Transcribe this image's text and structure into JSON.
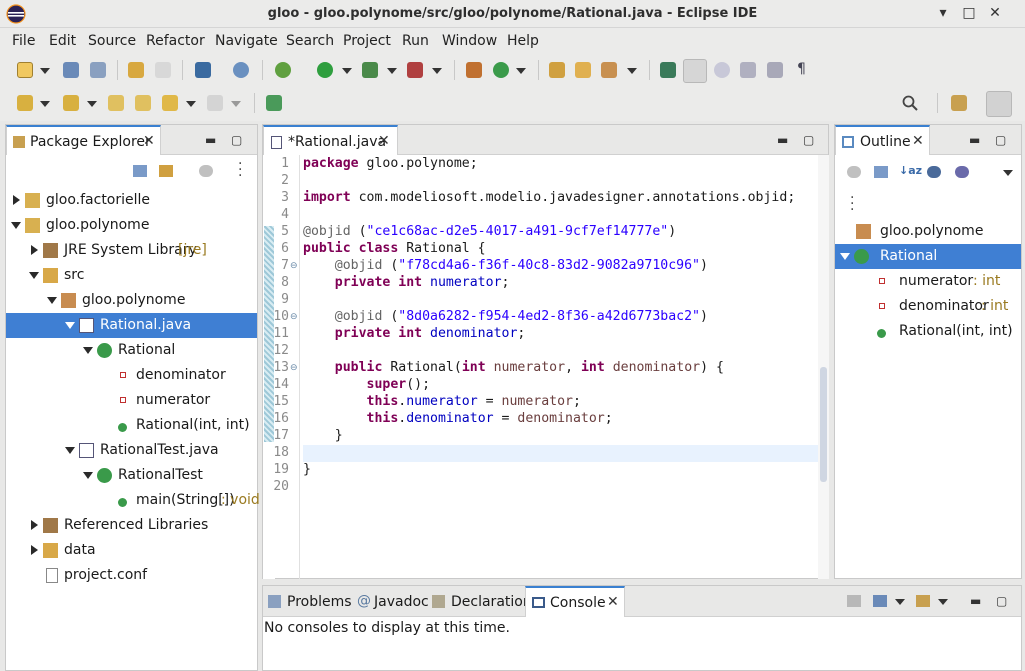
{
  "window": {
    "title": "gloo - gloo.polynome/src/gloo/polynome/Rational.java - Eclipse IDE",
    "min": "▾",
    "max": "□",
    "close": "✕"
  },
  "menu": [
    "File",
    "Edit",
    "Source",
    "Refactor",
    "Navigate",
    "Search",
    "Project",
    "Run",
    "Window",
    "Help"
  ],
  "package_explorer": {
    "title": "Package Explorer",
    "items": [
      {
        "label": "gloo.factorielle",
        "icon": "project-icon"
      },
      {
        "label": "gloo.polynome",
        "icon": "project-icon"
      },
      {
        "label": "JRE System Library",
        "suffix": "[jre]",
        "icon": "library-icon"
      },
      {
        "label": "src",
        "icon": "folder-icon"
      },
      {
        "label": "gloo.polynome",
        "icon": "package-icon"
      },
      {
        "label": "Rational.java",
        "icon": "java-file-icon"
      },
      {
        "label": "Rational",
        "icon": "class-icon"
      },
      {
        "label": "denominator",
        "icon": "field-icon"
      },
      {
        "label": "numerator",
        "icon": "field-icon"
      },
      {
        "label": "Rational(int, int)",
        "icon": "constructor-icon"
      },
      {
        "label": "RationalTest.java",
        "icon": "java-file-icon"
      },
      {
        "label": "RationalTest",
        "icon": "class-icon"
      },
      {
        "label": "main(String[])",
        "suffix": " : void",
        "icon": "method-icon"
      },
      {
        "label": "Referenced Libraries",
        "icon": "library-icon"
      },
      {
        "label": "data",
        "icon": "folder-icon"
      },
      {
        "label": "project.conf",
        "icon": "file-icon"
      }
    ]
  },
  "editor": {
    "tab": "*Rational.java",
    "lines": [
      "1",
      "2",
      "3",
      "4",
      "5",
      "6",
      "7",
      "8",
      "9",
      "10",
      "11",
      "12",
      "13",
      "14",
      "15",
      "16",
      "17",
      "18",
      "19",
      "20"
    ],
    "code": {
      "l1a": "package",
      "l1b": " gloo.polynome;",
      "l3a": "import",
      "l3b": " com.modeliosoft.modelio.javadesigner.annotations.objid;",
      "l5a": "@objid",
      "l5b": " (",
      "l5c": "\"ce1c68ac-d2e5-4017-a491-9cf7ef14777e\"",
      "l5d": ")",
      "l6a": "public class",
      "l6b": " Rational {",
      "l7a": "    @objid",
      "l7b": " (",
      "l7c": "\"f78cd4a6-f36f-40c8-83d2-9082a9710c96\"",
      "l7d": ")",
      "l8a": "    private int",
      "l8b": " ",
      "l8c": "numerator",
      "l8d": ";",
      "l10a": "    @objid",
      "l10b": " (",
      "l10c": "\"8d0a6282-f954-4ed2-8f36-a42d6773bac2\"",
      "l10d": ")",
      "l11a": "    private int",
      "l11b": " ",
      "l11c": "denominator",
      "l11d": ";",
      "l13a": "    public",
      "l13b": " Rational(",
      "l13c": "int",
      "l13d": " ",
      "l13e": "numerator",
      "l13f": ", ",
      "l13g": "int",
      "l13h": " ",
      "l13i": "denominator",
      "l13j": ") {",
      "l14a": "        super",
      "l14b": "();",
      "l15a": "        this",
      "l15b": ".",
      "l15c": "numerator",
      "l15d": " = ",
      "l15e": "numerator",
      "l15f": ";",
      "l16a": "        this",
      "l16b": ".",
      "l16c": "denominator",
      "l16d": " = ",
      "l16e": "denominator",
      "l16f": ";",
      "l17": "    }",
      "l19": "}"
    }
  },
  "outline": {
    "title": "Outline",
    "items": [
      {
        "label": "gloo.polynome",
        "icon": "package-icon"
      },
      {
        "label": "Rational",
        "icon": "class-icon"
      },
      {
        "label": "numerator",
        "suffix": " : int",
        "icon": "field-icon"
      },
      {
        "label": "denominator",
        "suffix": " : int",
        "icon": "field-icon"
      },
      {
        "label": "Rational(int, int)",
        "icon": "constructor-icon"
      }
    ]
  },
  "bottom": {
    "tabs": [
      "Problems",
      "Javadoc",
      "Declaration",
      "Console"
    ],
    "message": "No consoles to display at this time."
  }
}
